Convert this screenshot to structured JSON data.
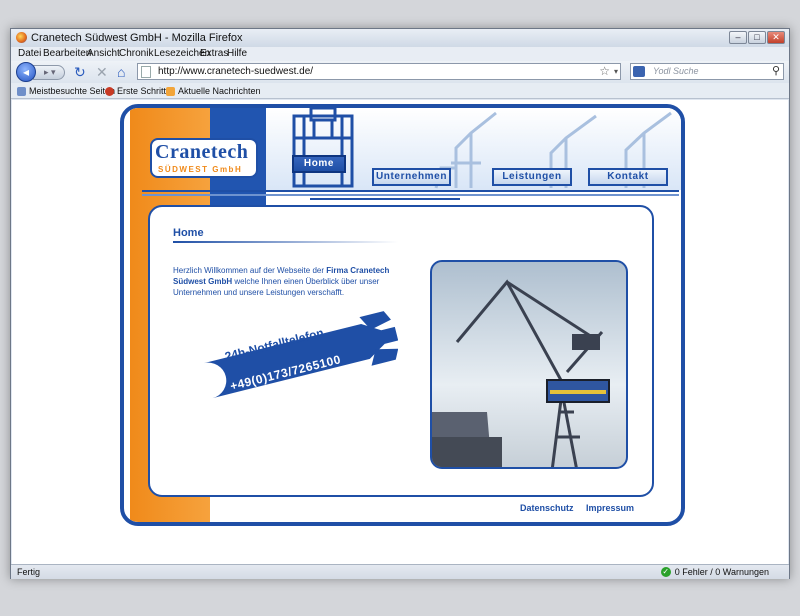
{
  "window": {
    "title": "Cranetech Südwest GmbH - Mozilla Firefox",
    "controls": {
      "minimize": "–",
      "maximize": "□",
      "close": "✕"
    }
  },
  "menu": [
    "Datei",
    "Bearbeiten",
    "Ansicht",
    "Chronik",
    "Lesezeichen",
    "Extras",
    "Hilfe"
  ],
  "nav": {
    "url": "http://www.cranetech-suedwest.de/",
    "search_placeholder": "Yodl Suche"
  },
  "bookmarks": [
    "Meistbesuchte Seiten",
    "Erste Schritte",
    "Aktuelle Nachrichten"
  ],
  "site": {
    "logo_main": "Cranetech",
    "logo_sub": "SÜDWEST GmbH",
    "nav_items": [
      "Home",
      "Unternehmen",
      "Leistungen",
      "Kontakt"
    ],
    "active_nav": "Home",
    "page_title": "Home",
    "intro_pre": "Herzlich Willkommen auf der Webseite der ",
    "intro_bold": "Firma Cranetech Südwest GmbH",
    "intro_post": " welche Ihnen einen Überblick über unser Unternehmen und unsere Leistungen verschafft.",
    "hotline_title": "24h-Notfalltelefon",
    "hotline_number": "+49(0)173/7265100",
    "footer_links": [
      "Datenschutz",
      "Impressum"
    ],
    "colors": {
      "brand_blue": "#1f4fa6",
      "brand_orange": "#f08a1a"
    }
  },
  "status": {
    "left": "Fertig",
    "right": "0 Fehler / 0 Warnungen"
  }
}
